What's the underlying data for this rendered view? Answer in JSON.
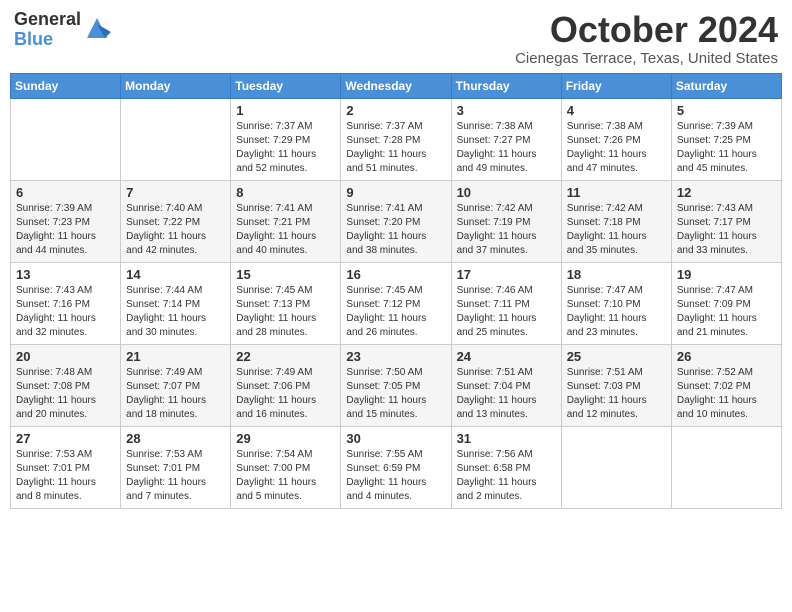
{
  "header": {
    "logo_general": "General",
    "logo_blue": "Blue",
    "month_title": "October 2024",
    "location": "Cienegas Terrace, Texas, United States"
  },
  "weekdays": [
    "Sunday",
    "Monday",
    "Tuesday",
    "Wednesday",
    "Thursday",
    "Friday",
    "Saturday"
  ],
  "weeks": [
    [
      {
        "day": "",
        "sunrise": "",
        "sunset": "",
        "daylight": ""
      },
      {
        "day": "",
        "sunrise": "",
        "sunset": "",
        "daylight": ""
      },
      {
        "day": "1",
        "sunrise": "Sunrise: 7:37 AM",
        "sunset": "Sunset: 7:29 PM",
        "daylight": "Daylight: 11 hours and 52 minutes."
      },
      {
        "day": "2",
        "sunrise": "Sunrise: 7:37 AM",
        "sunset": "Sunset: 7:28 PM",
        "daylight": "Daylight: 11 hours and 51 minutes."
      },
      {
        "day": "3",
        "sunrise": "Sunrise: 7:38 AM",
        "sunset": "Sunset: 7:27 PM",
        "daylight": "Daylight: 11 hours and 49 minutes."
      },
      {
        "day": "4",
        "sunrise": "Sunrise: 7:38 AM",
        "sunset": "Sunset: 7:26 PM",
        "daylight": "Daylight: 11 hours and 47 minutes."
      },
      {
        "day": "5",
        "sunrise": "Sunrise: 7:39 AM",
        "sunset": "Sunset: 7:25 PM",
        "daylight": "Daylight: 11 hours and 45 minutes."
      }
    ],
    [
      {
        "day": "6",
        "sunrise": "Sunrise: 7:39 AM",
        "sunset": "Sunset: 7:23 PM",
        "daylight": "Daylight: 11 hours and 44 minutes."
      },
      {
        "day": "7",
        "sunrise": "Sunrise: 7:40 AM",
        "sunset": "Sunset: 7:22 PM",
        "daylight": "Daylight: 11 hours and 42 minutes."
      },
      {
        "day": "8",
        "sunrise": "Sunrise: 7:41 AM",
        "sunset": "Sunset: 7:21 PM",
        "daylight": "Daylight: 11 hours and 40 minutes."
      },
      {
        "day": "9",
        "sunrise": "Sunrise: 7:41 AM",
        "sunset": "Sunset: 7:20 PM",
        "daylight": "Daylight: 11 hours and 38 minutes."
      },
      {
        "day": "10",
        "sunrise": "Sunrise: 7:42 AM",
        "sunset": "Sunset: 7:19 PM",
        "daylight": "Daylight: 11 hours and 37 minutes."
      },
      {
        "day": "11",
        "sunrise": "Sunrise: 7:42 AM",
        "sunset": "Sunset: 7:18 PM",
        "daylight": "Daylight: 11 hours and 35 minutes."
      },
      {
        "day": "12",
        "sunrise": "Sunrise: 7:43 AM",
        "sunset": "Sunset: 7:17 PM",
        "daylight": "Daylight: 11 hours and 33 minutes."
      }
    ],
    [
      {
        "day": "13",
        "sunrise": "Sunrise: 7:43 AM",
        "sunset": "Sunset: 7:16 PM",
        "daylight": "Daylight: 11 hours and 32 minutes."
      },
      {
        "day": "14",
        "sunrise": "Sunrise: 7:44 AM",
        "sunset": "Sunset: 7:14 PM",
        "daylight": "Daylight: 11 hours and 30 minutes."
      },
      {
        "day": "15",
        "sunrise": "Sunrise: 7:45 AM",
        "sunset": "Sunset: 7:13 PM",
        "daylight": "Daylight: 11 hours and 28 minutes."
      },
      {
        "day": "16",
        "sunrise": "Sunrise: 7:45 AM",
        "sunset": "Sunset: 7:12 PM",
        "daylight": "Daylight: 11 hours and 26 minutes."
      },
      {
        "day": "17",
        "sunrise": "Sunrise: 7:46 AM",
        "sunset": "Sunset: 7:11 PM",
        "daylight": "Daylight: 11 hours and 25 minutes."
      },
      {
        "day": "18",
        "sunrise": "Sunrise: 7:47 AM",
        "sunset": "Sunset: 7:10 PM",
        "daylight": "Daylight: 11 hours and 23 minutes."
      },
      {
        "day": "19",
        "sunrise": "Sunrise: 7:47 AM",
        "sunset": "Sunset: 7:09 PM",
        "daylight": "Daylight: 11 hours and 21 minutes."
      }
    ],
    [
      {
        "day": "20",
        "sunrise": "Sunrise: 7:48 AM",
        "sunset": "Sunset: 7:08 PM",
        "daylight": "Daylight: 11 hours and 20 minutes."
      },
      {
        "day": "21",
        "sunrise": "Sunrise: 7:49 AM",
        "sunset": "Sunset: 7:07 PM",
        "daylight": "Daylight: 11 hours and 18 minutes."
      },
      {
        "day": "22",
        "sunrise": "Sunrise: 7:49 AM",
        "sunset": "Sunset: 7:06 PM",
        "daylight": "Daylight: 11 hours and 16 minutes."
      },
      {
        "day": "23",
        "sunrise": "Sunrise: 7:50 AM",
        "sunset": "Sunset: 7:05 PM",
        "daylight": "Daylight: 11 hours and 15 minutes."
      },
      {
        "day": "24",
        "sunrise": "Sunrise: 7:51 AM",
        "sunset": "Sunset: 7:04 PM",
        "daylight": "Daylight: 11 hours and 13 minutes."
      },
      {
        "day": "25",
        "sunrise": "Sunrise: 7:51 AM",
        "sunset": "Sunset: 7:03 PM",
        "daylight": "Daylight: 11 hours and 12 minutes."
      },
      {
        "day": "26",
        "sunrise": "Sunrise: 7:52 AM",
        "sunset": "Sunset: 7:02 PM",
        "daylight": "Daylight: 11 hours and 10 minutes."
      }
    ],
    [
      {
        "day": "27",
        "sunrise": "Sunrise: 7:53 AM",
        "sunset": "Sunset: 7:01 PM",
        "daylight": "Daylight: 11 hours and 8 minutes."
      },
      {
        "day": "28",
        "sunrise": "Sunrise: 7:53 AM",
        "sunset": "Sunset: 7:01 PM",
        "daylight": "Daylight: 11 hours and 7 minutes."
      },
      {
        "day": "29",
        "sunrise": "Sunrise: 7:54 AM",
        "sunset": "Sunset: 7:00 PM",
        "daylight": "Daylight: 11 hours and 5 minutes."
      },
      {
        "day": "30",
        "sunrise": "Sunrise: 7:55 AM",
        "sunset": "Sunset: 6:59 PM",
        "daylight": "Daylight: 11 hours and 4 minutes."
      },
      {
        "day": "31",
        "sunrise": "Sunrise: 7:56 AM",
        "sunset": "Sunset: 6:58 PM",
        "daylight": "Daylight: 11 hours and 2 minutes."
      },
      {
        "day": "",
        "sunrise": "",
        "sunset": "",
        "daylight": ""
      },
      {
        "day": "",
        "sunrise": "",
        "sunset": "",
        "daylight": ""
      }
    ]
  ]
}
